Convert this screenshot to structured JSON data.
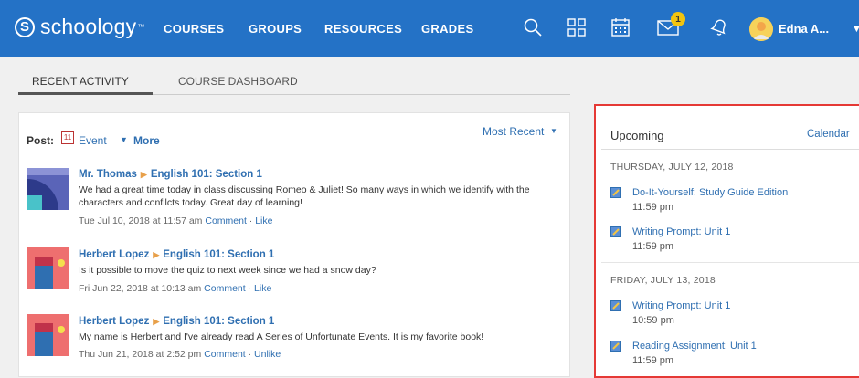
{
  "nav": {
    "logo_text": "schoology",
    "links": [
      "COURSES",
      "GROUPS",
      "RESOURCES",
      "GRADES"
    ],
    "notification_count": "1",
    "user_name": "Edna A...",
    "colors": {
      "bar": "#2472c6",
      "badge": "#f2c40f"
    }
  },
  "tabs": [
    "RECENT ACTIVITY",
    "COURSE DASHBOARD"
  ],
  "composer": {
    "post_label": "Post:",
    "event_label": "Event",
    "event_icon_day": "11",
    "more_label": "More",
    "sort_label": "Most Recent"
  },
  "posts": [
    {
      "author": "Mr. Thomas",
      "course": "English 101: Section 1",
      "body": "We had a great time today in class discussing Romeo & Juliet! So many ways in which we identify with the characters and confilcts today. Great day of learning!",
      "timestamp": "Tue Jul 10, 2018 at 11:57 am",
      "comment": "Comment",
      "like": "Like"
    },
    {
      "author": "Herbert Lopez",
      "course": "English 101: Section 1",
      "body": "Is it possible to move the quiz to next week since we had a snow day?",
      "timestamp": "Fri Jun 22, 2018 at 10:13 am",
      "comment": "Comment",
      "like": "Like"
    },
    {
      "author": "Herbert Lopez",
      "course": "English 101: Section 1",
      "body": "My name is Herbert and I've already read A Series of Unfortunate Events. It is my favorite book!",
      "timestamp": "Thu Jun 21, 2018 at 2:52 pm",
      "comment": "Comment",
      "like": "Unlike"
    }
  ],
  "upcoming": {
    "title": "Upcoming",
    "calendar_link": "Calendar",
    "groups": [
      {
        "date": "THURSDAY, JULY 12, 2018",
        "items": [
          {
            "title": "Do-It-Yourself: Study Guide Edition",
            "time": "11:59 pm"
          },
          {
            "title": "Writing Prompt: Unit 1",
            "time": "11:59 pm"
          }
        ]
      },
      {
        "date": "FRIDAY, JULY 13, 2018",
        "items": [
          {
            "title": "Writing Prompt: Unit 1",
            "time": "10:59 pm"
          },
          {
            "title": "Reading Assignment: Unit 1",
            "time": "11:59 pm"
          }
        ]
      }
    ]
  }
}
